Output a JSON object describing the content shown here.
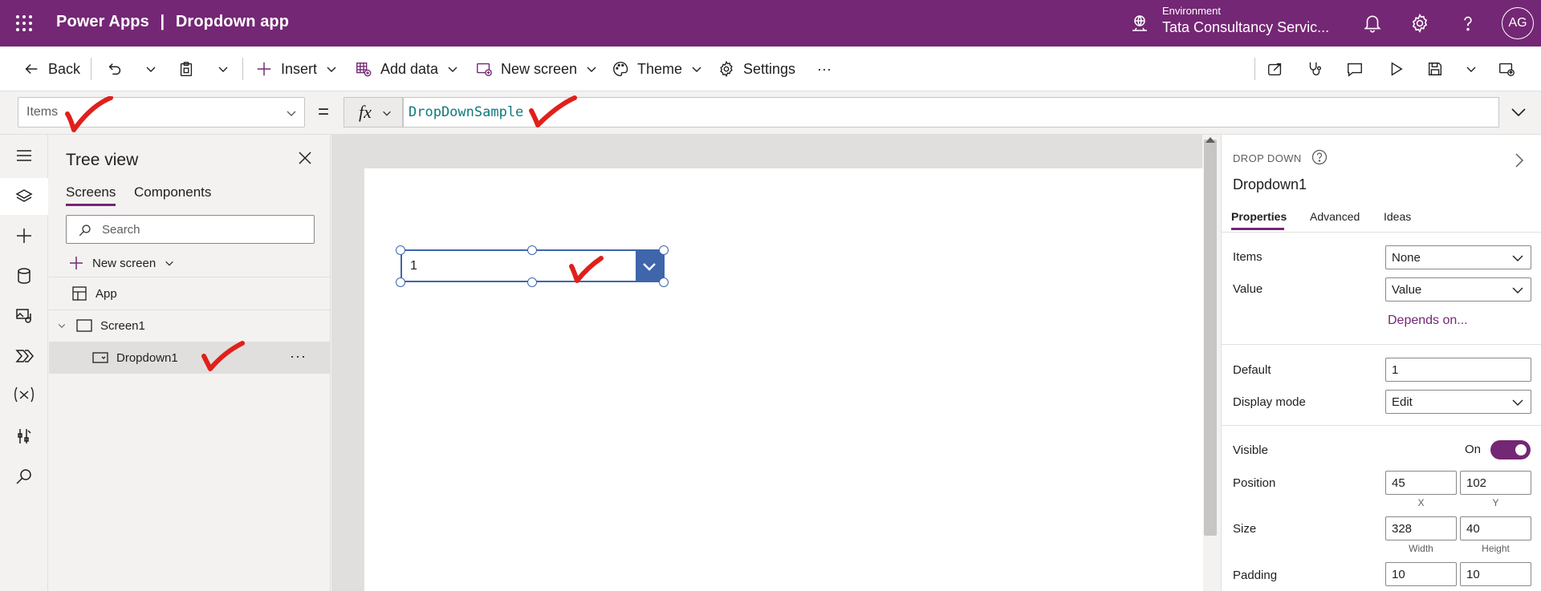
{
  "titlebar": {
    "app": "Power Apps",
    "separator": "|",
    "document": "Dropdown app",
    "environment_label": "Environment",
    "environment_value": "Tata Consultancy Servic...",
    "avatar_initials": "AG"
  },
  "commandbar": {
    "back": "Back",
    "insert": "Insert",
    "add_data": "Add data",
    "new_screen": "New screen",
    "theme": "Theme",
    "settings": "Settings",
    "more": "···"
  },
  "formula": {
    "property": "Items",
    "equals": "=",
    "fx": "fx",
    "expression": "DropDownSample"
  },
  "tree": {
    "title": "Tree view",
    "tabs": [
      "Screens",
      "Components"
    ],
    "search_placeholder": "Search",
    "new_screen": "New screen",
    "items": [
      {
        "label": "App"
      },
      {
        "label": "Screen1"
      },
      {
        "label": "Dropdown1",
        "more": "···"
      }
    ]
  },
  "canvas": {
    "dropdown_value": "1"
  },
  "properties": {
    "type": "DROP DOWN",
    "name": "Dropdown1",
    "tabs": [
      "Properties",
      "Advanced",
      "Ideas"
    ],
    "items_label": "Items",
    "items_value": "None",
    "value_label": "Value",
    "value_value": "Value",
    "depends_on": "Depends on...",
    "default_label": "Default",
    "default_value": "1",
    "display_mode_label": "Display mode",
    "display_mode_value": "Edit",
    "visible_label": "Visible",
    "visible_state": "On",
    "position_label": "Position",
    "position_x": "45",
    "position_y": "102",
    "x_caption": "X",
    "y_caption": "Y",
    "size_label": "Size",
    "size_width": "328",
    "size_height": "40",
    "width_caption": "Width",
    "height_caption": "Height",
    "padding_label": "Padding",
    "padding_1": "10",
    "padding_2": "10"
  },
  "colors": {
    "brand": "#742774",
    "selection": "#3f65ab",
    "formula_text": "#0f7b7b",
    "annotation": "#e0201b"
  }
}
